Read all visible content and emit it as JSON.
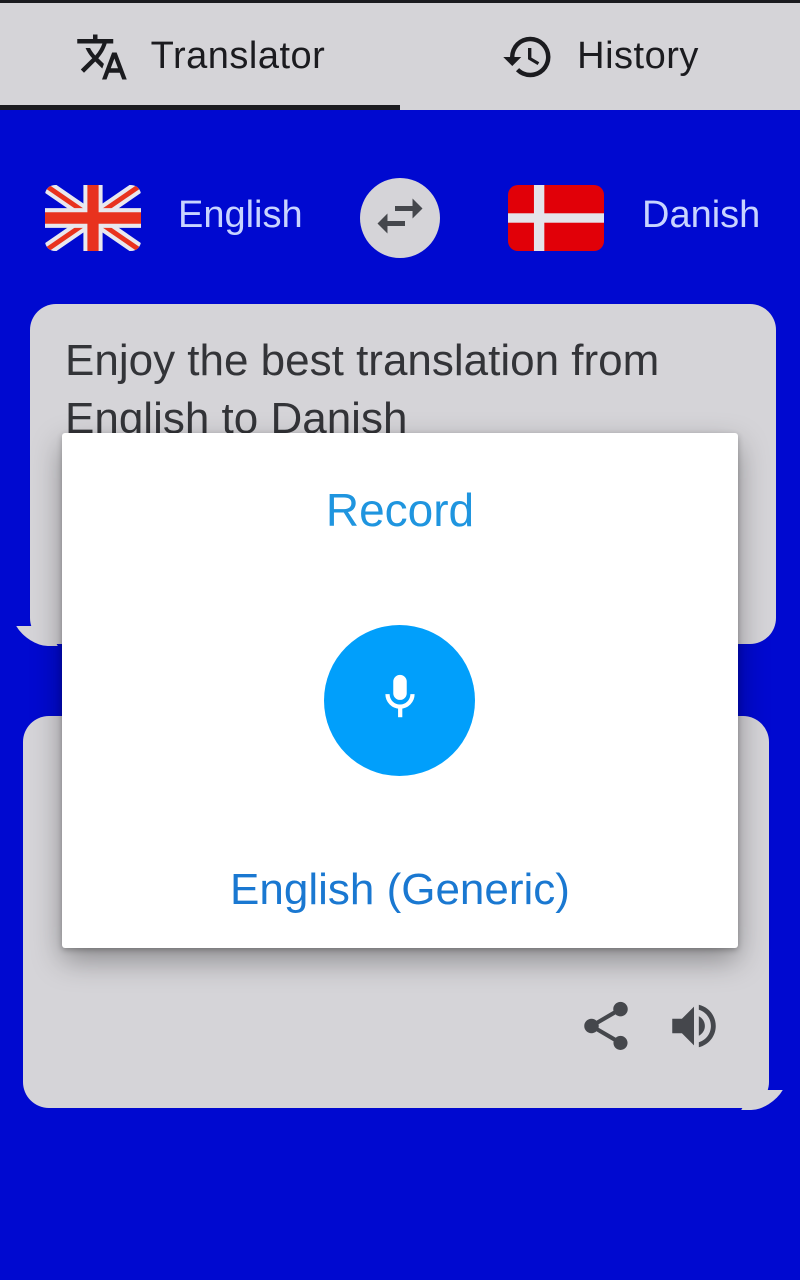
{
  "tabs": [
    {
      "label": "Translator",
      "icon": "translate-icon",
      "active": true
    },
    {
      "label": "History",
      "icon": "history-icon",
      "active": false
    }
  ],
  "languages": {
    "source": {
      "label": "English",
      "flag": "uk-flag-icon"
    },
    "target": {
      "label": "Danish",
      "flag": "denmark-flag-icon"
    },
    "swap_icon": "swap-arrows-icon"
  },
  "source_card": {
    "text": "Enjoy the best translation from English to Danish"
  },
  "target_card": {
    "actions": [
      {
        "name": "share",
        "icon": "share-icon"
      },
      {
        "name": "speak",
        "icon": "speaker-icon"
      }
    ]
  },
  "record_dialog": {
    "title": "Record",
    "mic_icon": "microphone-icon",
    "language": "English (Generic)"
  },
  "colors": {
    "background": "#0009d0",
    "tabbar": "#d5d4d8",
    "card": "#d5d4d8",
    "accent": "#019ffb",
    "dialog_title": "#1f95df",
    "dialog_language": "#1a78d1"
  }
}
